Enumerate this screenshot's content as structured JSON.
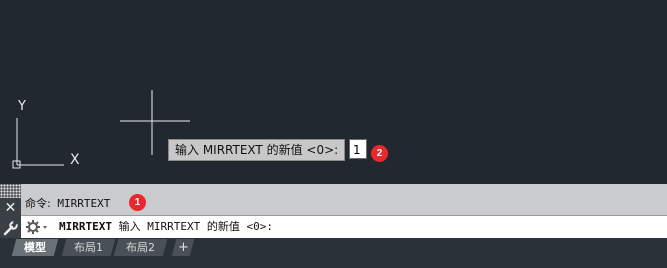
{
  "canvas": {
    "ucs_y_label": "Y",
    "ucs_x_label": "X"
  },
  "dynamic_input": {
    "prompt": "输入 MIRRTEXT 的新值 <0>:",
    "value": "1",
    "badge": "2"
  },
  "command_panel": {
    "history_prefix": "命令:",
    "history_command": "MIRRTEXT",
    "history_badge": "1",
    "close_glyph": "✕",
    "line_command": "MIRRTEXT",
    "line_prompt": "输入 MIRRTEXT 的新值 <0>:"
  },
  "tabs": {
    "items": [
      {
        "label": "模型"
      },
      {
        "label": "布局1"
      },
      {
        "label": "布局2"
      }
    ],
    "add_label": "+"
  },
  "colors": {
    "canvas_background": "#212830",
    "badge_red": "#e8282c",
    "command_panel": "#c9cbcd"
  }
}
